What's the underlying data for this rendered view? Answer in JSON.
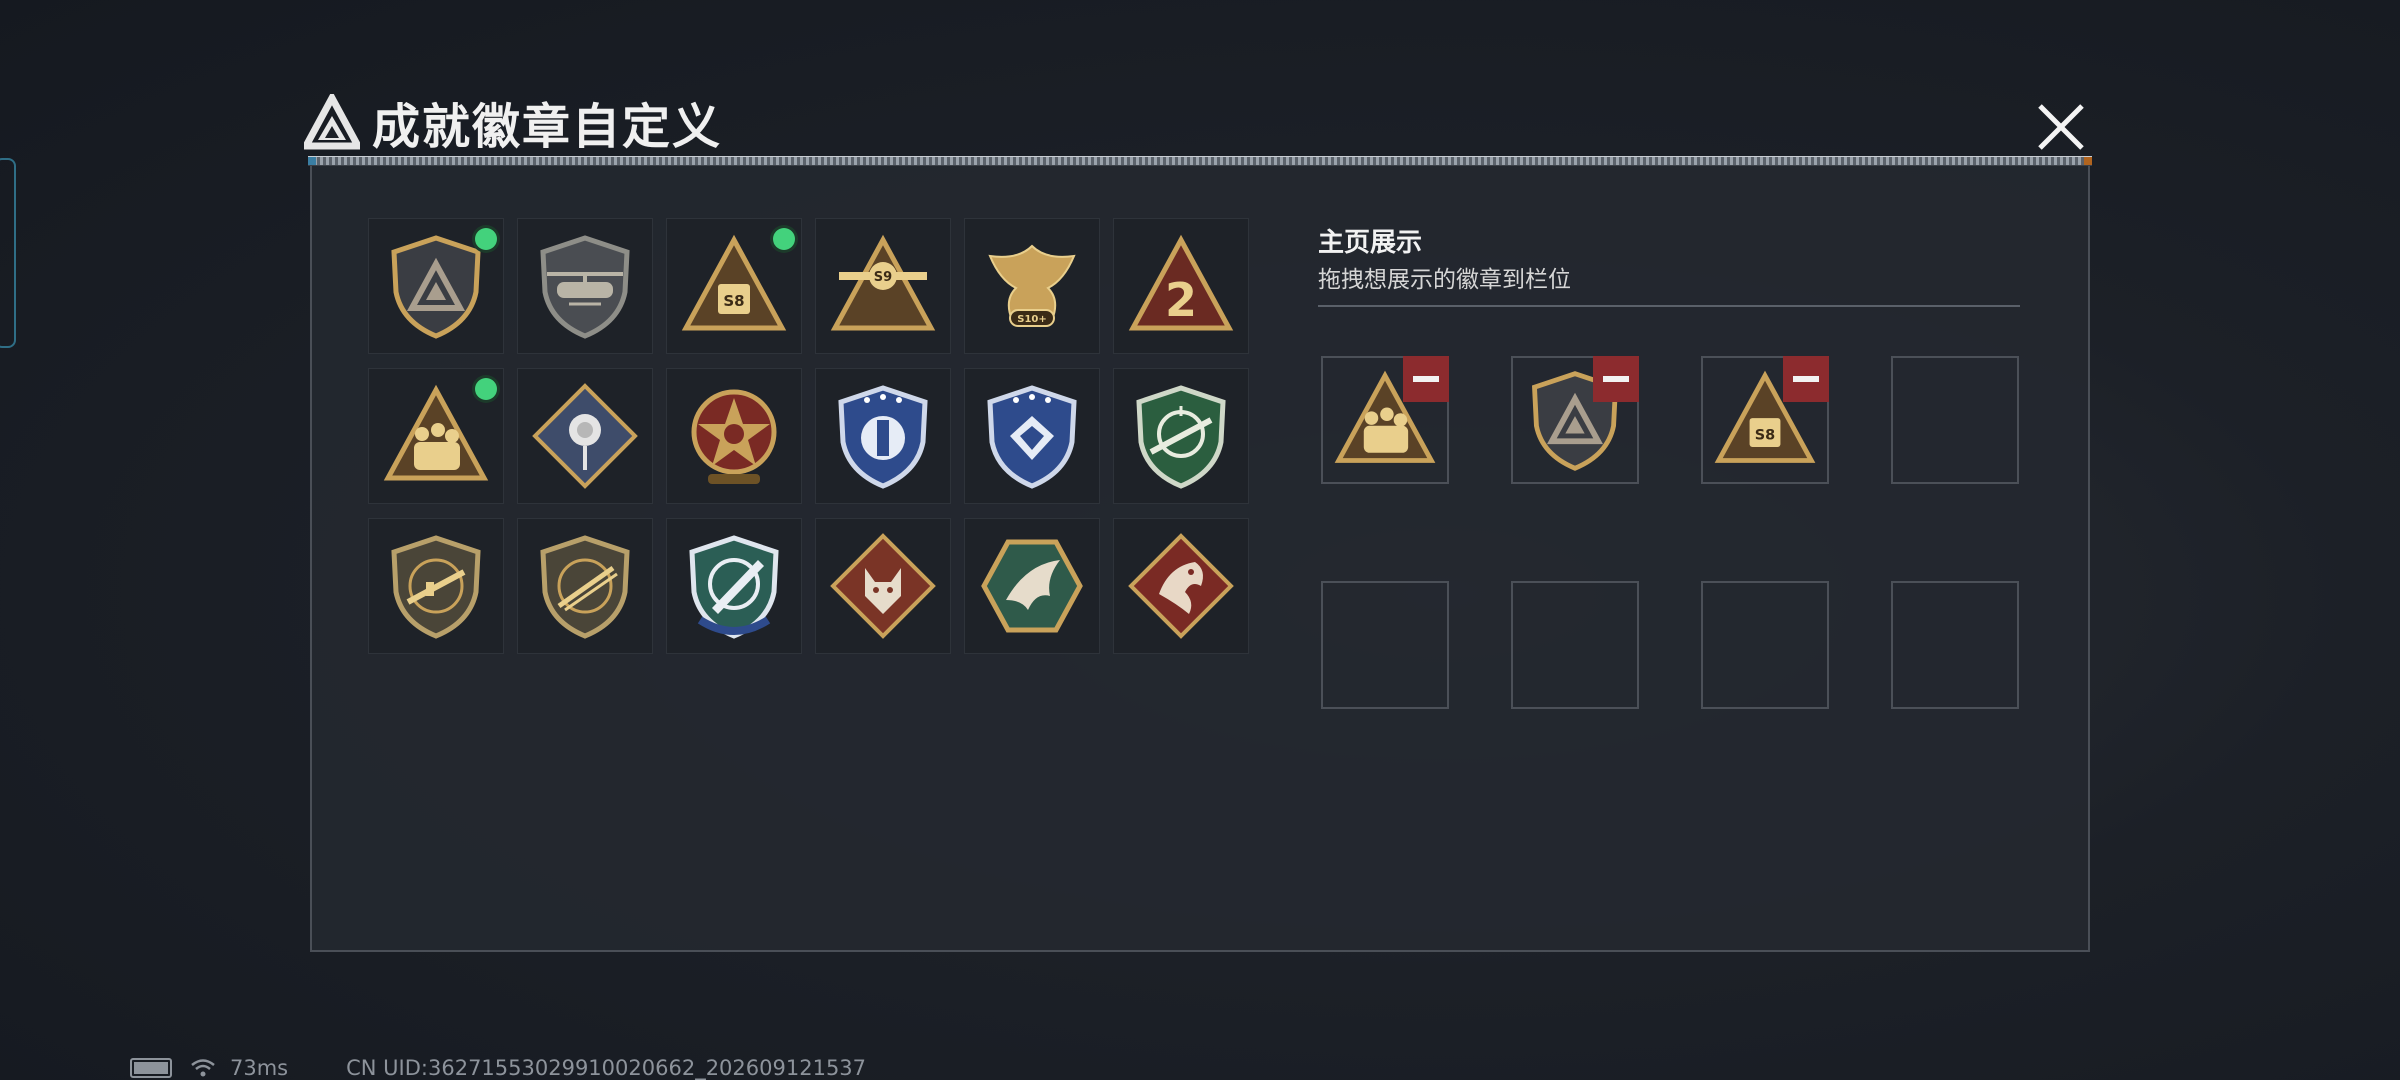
{
  "header": {
    "title": "成就徽章自定义"
  },
  "badges": [
    {
      "icon": "shield-triangle-badge",
      "equipped": true
    },
    {
      "icon": "helicopter-badge",
      "equipped": false
    },
    {
      "icon": "s8-triangle-badge",
      "equipped": true
    },
    {
      "icon": "s9-aircraft-badge",
      "equipped": false
    },
    {
      "icon": "s10-phoenix-badge",
      "equipped": false
    },
    {
      "icon": "number-2-badge",
      "equipped": false
    },
    {
      "icon": "soldiers-triangle-badge",
      "equipped": true
    },
    {
      "icon": "rose-diamond-badge",
      "equipped": false
    },
    {
      "icon": "red-star-medal-badge",
      "equipped": false
    },
    {
      "icon": "blue-wing-shield-badge",
      "equipped": false
    },
    {
      "icon": "blue-gem-shield-badge",
      "equipped": false
    },
    {
      "icon": "green-sniper-badge",
      "equipped": false
    },
    {
      "icon": "rifle-shield-badge",
      "equipped": false
    },
    {
      "icon": "shotgun-shield-badge",
      "equipped": false
    },
    {
      "icon": "blue-knife-shield-badge",
      "equipped": false
    },
    {
      "icon": "wolf-diamond-badge",
      "equipped": false
    },
    {
      "icon": "dragon-hexagon-badge",
      "equipped": false
    },
    {
      "icon": "red-dragon-diamond-badge",
      "equipped": false
    }
  ],
  "showcase": {
    "title": "主页展示",
    "subtitle": "拖拽想展示的徽章到栏位",
    "slots": [
      {
        "icon": "soldiers-triangle-badge",
        "filled": true
      },
      {
        "icon": "shield-triangle-badge",
        "filled": true
      },
      {
        "icon": "s8-triangle-badge",
        "filled": true
      },
      {
        "icon": "",
        "filled": false
      },
      {
        "icon": "",
        "filled": false
      },
      {
        "icon": "",
        "filled": false
      },
      {
        "icon": "",
        "filled": false
      },
      {
        "icon": "",
        "filled": false
      }
    ]
  },
  "status": {
    "ping": "73ms",
    "uid": "CN UID:3627155302991002066​2_202609121537"
  },
  "colors": {
    "gold": "#c9a25a",
    "equipped_indicator": "#43d27c",
    "remove_button": "#8c2b2e",
    "panel": "#24282f"
  }
}
